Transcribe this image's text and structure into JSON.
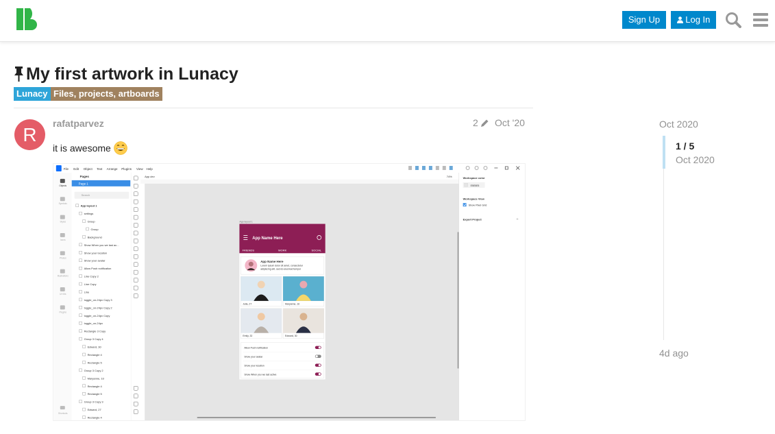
{
  "header": {
    "logo_icon": "lunacy-logo-icon",
    "signup_label": "Sign Up",
    "login_label": "Log In",
    "login_icon": "user-icon",
    "search_icon": "search-icon",
    "menu_icon": "hamburger-menu-icon"
  },
  "topic": {
    "pin_icon": "pin-icon",
    "title": "My first artwork in Lunacy",
    "categories": [
      {
        "label": "Lunacy",
        "color": "#2ea5d9"
      },
      {
        "label": "Files, projects, artboards",
        "color": "#a0825f"
      }
    ]
  },
  "post": {
    "avatar_letter": "R",
    "avatar_color": "#e45c67",
    "username": "rafatparvez",
    "edit_count": "2",
    "edit_icon": "pencil-icon",
    "date": "Oct '20",
    "text": "it is awesome",
    "emoji_icon": "grinning-face-icon"
  },
  "screenshot": {
    "menu": [
      "File",
      "Edit",
      "Object",
      "Text",
      "Arrange",
      "Plugins",
      "View",
      "Help"
    ],
    "left_rail": [
      "Objects",
      "Symbols",
      "Styles",
      "Icons",
      "Photos",
      "Illustrations",
      "UI Kits",
      "Plugins"
    ],
    "left_rail_bottom": "Shortcuts",
    "pages_header": "Pages",
    "page_selected": "Page 1",
    "search_placeholder": "Search",
    "layers": [
      "App layout 1",
      "settings",
      "Group",
      "Group",
      "Background",
      "Show When you we last ac...",
      "Show your location",
      "Show your avatar",
      "Allow Push notification",
      "Line Copy 2",
      "Line Copy",
      "Line",
      "toggle_on-24px Copy 3",
      "toggle_on-24px Copy 2",
      "toggle_on-24px Copy",
      "toggle_on-24px",
      "Rectangle 3 Copy",
      "Group 3 Copy 4",
      "Edward, 30",
      "Rectangle 4",
      "Rectangle 5",
      "Group 3 Copy 2",
      "Maryanne, 10",
      "Rectangle 4",
      "Rectangle 5",
      "Group 3 Copy 3",
      "Edward, 27",
      "Rectangle 4"
    ],
    "canvas_tab": "App dev",
    "zoom": "74%",
    "artboard_label": "App layout 1",
    "app_title": "App Name Here",
    "app_tabs": [
      "FRIENDS",
      "WORK",
      "SOCIAL"
    ],
    "card_title": "App Name Here",
    "card_text_1": "Lorem ipsum dolor sit amet, consectetur",
    "card_text_2": "adipiscing elit, sed do eiusmod tempor",
    "photos": [
      "Julia, 27",
      "Maryanne, 10",
      "Emily, 32",
      "Edward, 30"
    ],
    "settings": [
      "Allow Push notification",
      "Show your avatar",
      "Show your location",
      "Show When you we last active"
    ],
    "inspector_workspace_color": "Workspace color",
    "inspector_color_value": "E5E5E5",
    "inspector_workspace_view": "Workspace View",
    "inspector_show_pixel_grid": "Show Pixel Grid",
    "inspector_export": "Export Project"
  },
  "timeline": {
    "top_date": "Oct 2020",
    "count": "1 / 5",
    "count_date": "Oct 2020",
    "bottom_label": "4d ago"
  }
}
